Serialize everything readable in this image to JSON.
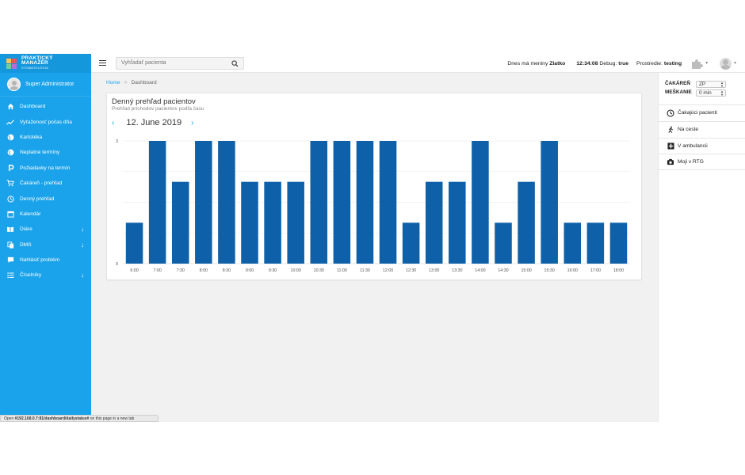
{
  "app": {
    "brand_line1": "PRAKTICKÝ",
    "brand_line2": "MANAŽÉR",
    "brand_line3": "STOMATOLÓGIA"
  },
  "user": {
    "name": "Super Administrator"
  },
  "sidebar": {
    "items": [
      {
        "label": "Dashboard",
        "icon": "home-icon"
      },
      {
        "label": "Vyťaženosť počas dňa",
        "icon": "trend-icon"
      },
      {
        "label": "Kartotéka",
        "icon": "globe-icon"
      },
      {
        "label": "Neplatné termíny",
        "icon": "globe-icon"
      },
      {
        "label": "Požiadavky na termín",
        "icon": "parking-icon"
      },
      {
        "label": "Čakáreň - prehľad",
        "icon": "cart-icon"
      },
      {
        "label": "Denný prehľad",
        "icon": "clock-icon"
      },
      {
        "label": "Kalendár",
        "icon": "calendar-icon"
      },
      {
        "label": "Diáre",
        "icon": "book-icon",
        "expand": "↓"
      },
      {
        "label": "DMS",
        "icon": "copy-icon",
        "expand": "↓"
      },
      {
        "label": "Nahlásiť problém",
        "icon": "comment-icon"
      },
      {
        "label": "Číselníky",
        "icon": "list-icon",
        "expand": "↓"
      }
    ]
  },
  "search": {
    "placeholder": "Vyhľadať pacienta"
  },
  "topbar": {
    "nameday_prefix": "Dnes má meniny",
    "nameday_name": "Zlatko",
    "time": "12:34:08",
    "debug_label": "Debug:",
    "debug_value": "true",
    "env_label": "Prostredie:",
    "env_value": "testing"
  },
  "breadcrumb": {
    "home": "Home",
    "current": "Dashboard"
  },
  "card": {
    "title": "Denný prehľad pacientov",
    "subtitle": "Prehľad príchodov pacientov podľa času",
    "date": "12. June 2019"
  },
  "chart_data": {
    "type": "bar",
    "categories": [
      "6:00",
      "7:00",
      "7:30",
      "8:00",
      "8:30",
      "9:00",
      "9:30",
      "10:00",
      "10:30",
      "11:00",
      "11:30",
      "12:00",
      "12:30",
      "13:00",
      "13:30",
      "14:00",
      "14:30",
      "15:00",
      "15:30",
      "16:00",
      "17:00",
      "18:00"
    ],
    "values": [
      1,
      3,
      2,
      3,
      3,
      2,
      2,
      2,
      3,
      3,
      3,
      3,
      1,
      2,
      2,
      3,
      1,
      2,
      3,
      1,
      1,
      1
    ],
    "ylim": [
      0,
      3
    ],
    "yticks": [
      "0",
      "3"
    ],
    "bar_color": "#0e61a8",
    "grid": true
  },
  "rpanel": {
    "cakaren_label": "ČAKÁREŇ",
    "cakaren_value": "ZP",
    "meskanie_label": "MEŠKANIE",
    "meskanie_value": "0 min",
    "items": [
      {
        "label": "Čakajúci pacienti",
        "icon": "clock-icon"
      },
      {
        "label": "Na ceste",
        "icon": "walking-icon"
      },
      {
        "label": "V ambulancii",
        "icon": "plus-square-icon"
      },
      {
        "label": "Moji v RTG",
        "icon": "camera-icon"
      }
    ]
  },
  "statusbar": {
    "prefix": "Open",
    "url": "#192.168.0.7:81/dashboard/dailystatus#",
    "suffix": "on this page in a new tab"
  }
}
